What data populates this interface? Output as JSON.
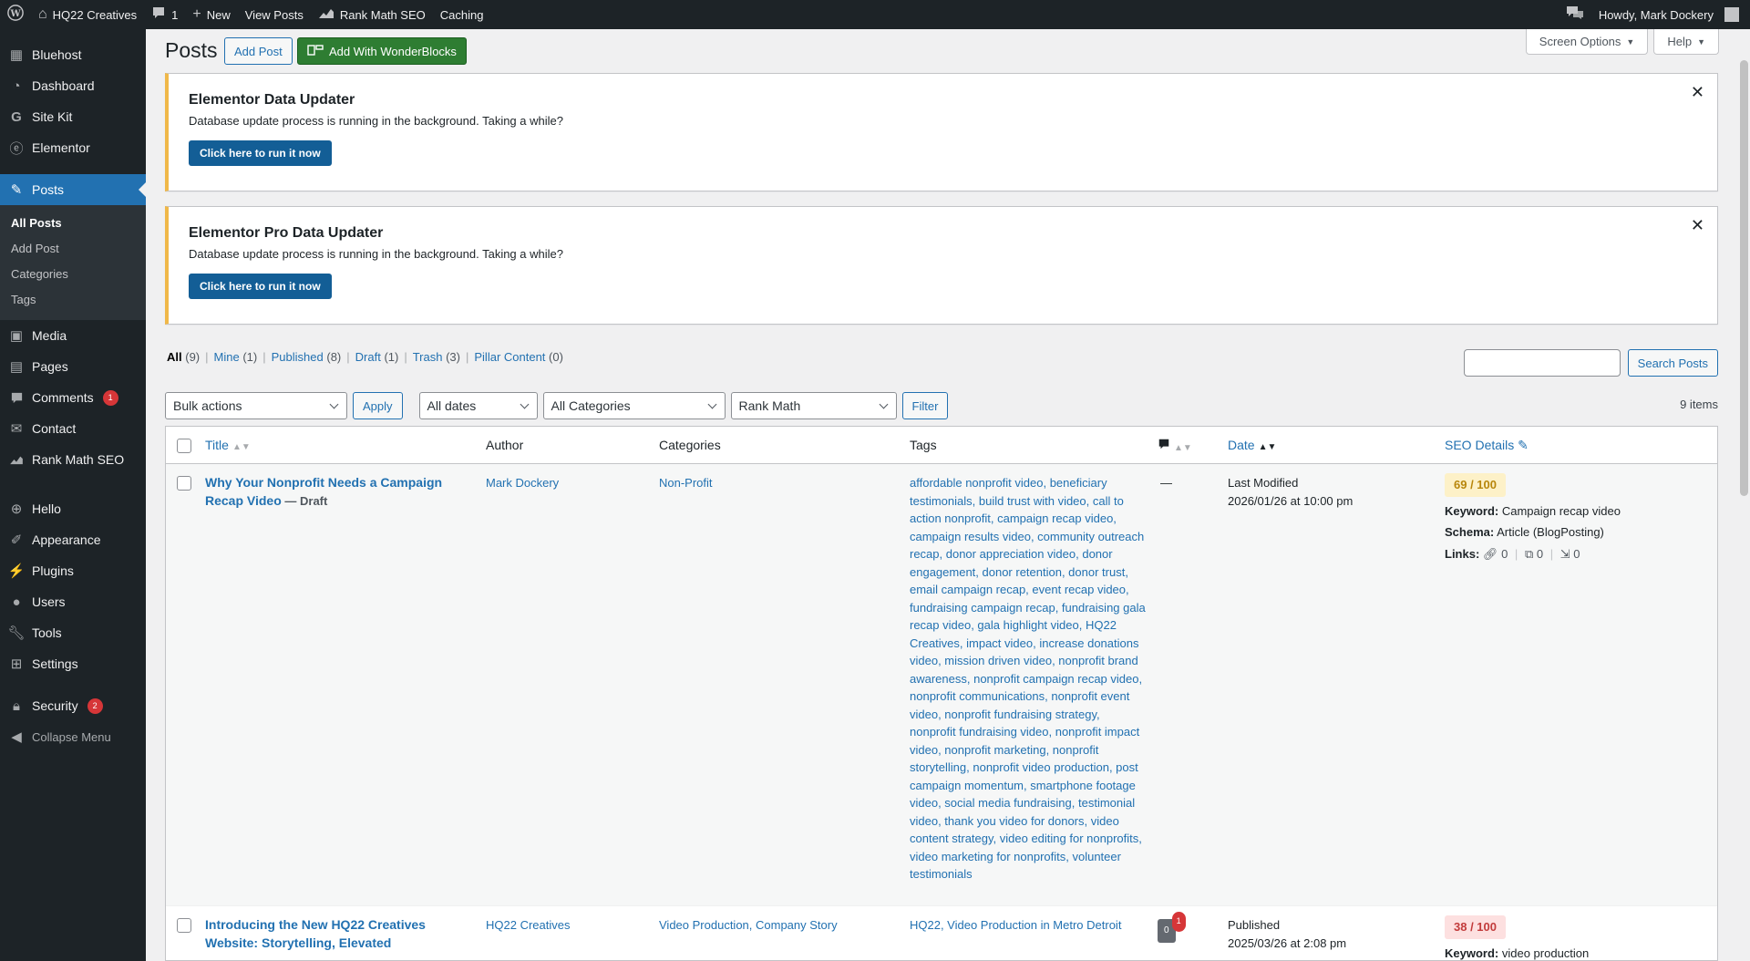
{
  "adminbar": {
    "site_name": "HQ22 Creatives",
    "comments_count": "1",
    "new_label": "New",
    "view_posts": "View Posts",
    "rank_math": "Rank Math SEO",
    "caching": "Caching",
    "howdy": "Howdy, Mark Dockery"
  },
  "sidebar": {
    "items_top": [
      {
        "label": "Bluehost",
        "icon": "grid-icon"
      },
      {
        "label": "Dashboard",
        "icon": "dashboard-icon"
      },
      {
        "label": "Site Kit",
        "icon": "google-icon"
      },
      {
        "label": "Elementor",
        "icon": "elementor-icon"
      }
    ],
    "posts_label": "Posts",
    "posts_sub": [
      "All Posts",
      "Add Post",
      "Categories",
      "Tags"
    ],
    "items_mid": [
      {
        "label": "Media",
        "icon": "media-icon"
      },
      {
        "label": "Pages",
        "icon": "pages-icon"
      },
      {
        "label": "Comments",
        "icon": "comments-icon",
        "badge": "1"
      },
      {
        "label": "Contact",
        "icon": "mail-icon"
      },
      {
        "label": "Rank Math SEO",
        "icon": "rankmath-icon"
      }
    ],
    "items_bottom": [
      {
        "label": "Hello",
        "icon": "hello-icon"
      },
      {
        "label": "Appearance",
        "icon": "brush-icon"
      },
      {
        "label": "Plugins",
        "icon": "plugin-icon"
      },
      {
        "label": "Users",
        "icon": "users-icon"
      },
      {
        "label": "Tools",
        "icon": "wrench-icon"
      },
      {
        "label": "Settings",
        "icon": "settings-icon"
      }
    ],
    "security_label": "Security",
    "security_badge": "2",
    "collapse": "Collapse Menu"
  },
  "header": {
    "title": "Posts",
    "add_post": "Add Post",
    "wonderblocks": "Add With WonderBlocks",
    "screen_options": "Screen Options",
    "help": "Help"
  },
  "notices": [
    {
      "title": "Elementor Data Updater",
      "text": "Database update process is running in the background. Taking a while?",
      "button": "Click here to run it now"
    },
    {
      "title": "Elementor Pro Data Updater",
      "text": "Database update process is running in the background. Taking a while?",
      "button": "Click here to run it now"
    }
  ],
  "filters": {
    "views": [
      {
        "label": "All",
        "count": "(9)"
      },
      {
        "label": "Mine",
        "count": "(1)"
      },
      {
        "label": "Published",
        "count": "(8)"
      },
      {
        "label": "Draft",
        "count": "(1)"
      },
      {
        "label": "Trash",
        "count": "(3)"
      },
      {
        "label": "Pillar Content",
        "count": "(0)"
      }
    ],
    "bulk_actions": "Bulk actions",
    "apply": "Apply",
    "all_dates": "All dates",
    "all_categories": "All Categories",
    "rank_math": "Rank Math",
    "filter": "Filter",
    "search_button": "Search Posts",
    "items_count": "9 items"
  },
  "table": {
    "headers": {
      "title": "Title",
      "author": "Author",
      "categories": "Categories",
      "tags": "Tags",
      "date": "Date",
      "seo": "SEO Details"
    },
    "rows": [
      {
        "title": "Why Your Nonprofit Needs a Campaign Recap Video",
        "state": " — Draft",
        "author": "Mark Dockery",
        "categories": "Non-Profit",
        "tags": "affordable nonprofit video, beneficiary testimonials, build trust with video, call to action nonprofit, campaign recap video, campaign results video, community outreach recap, donor appreciation video, donor engagement, donor retention, donor trust, email campaign recap, event recap video, fundraising campaign recap, fundraising gala recap video, gala highlight video, HQ22 Creatives, impact video, increase donations video, mission driven video, nonprofit brand awareness, nonprofit campaign recap video, nonprofit communications, nonprofit event video, nonprofit fundraising strategy, nonprofit fundraising video, nonprofit impact video, nonprofit marketing, nonprofit storytelling, nonprofit video production, post campaign momentum, smartphone footage video, social media fundraising, testimonial video, thank you video for donors, video content strategy, video editing for nonprofits, video marketing for nonprofits, volunteer testimonials",
        "comments": "—",
        "date_status": "Last Modified",
        "date": "2026/01/26 at 10:00 pm",
        "score": "69 / 100",
        "keyword_label": "Keyword:",
        "keyword": "Campaign recap video",
        "schema_label": "Schema:",
        "schema": "Article (BlogPosting)",
        "links_label": "Links:",
        "links": [
          "0",
          "0",
          "0"
        ]
      },
      {
        "title": "Introducing the New HQ22 Creatives Website: Storytelling, Elevated",
        "author": "HQ22 Creatives",
        "categories": "Video Production, Company Story",
        "tags": "HQ22, Video Production in Metro Detroit",
        "comments": "0",
        "comments_pending": "1",
        "date_status": "Published",
        "date": "2025/03/26 at 2:08 pm",
        "score": "38 / 100",
        "keyword_label": "Keyword:",
        "keyword": "video production"
      }
    ]
  }
}
